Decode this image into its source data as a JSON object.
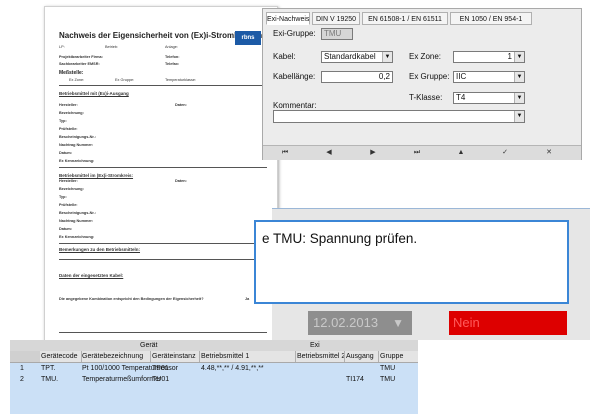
{
  "document": {
    "title": "Nachweis der Eigensicherheit von (Ex)i-Stromkreisen",
    "lp_label": "LP:",
    "betrieb_label": "Betrieb:",
    "anlage_label": "Anlage:",
    "proj_label": "Projektbearbeiter Firma:",
    "sach_label": "Sachbearbeiter EMSR:",
    "telefon_label": "Telefon:",
    "telefax_label": "Telefax:",
    "messstelle_label": "Meßstelle:",
    "exzone_label": "Ex Zone:",
    "exgruppe_label": "Ex Gruppe:",
    "tempklasse_label": "Temperaturklasse:",
    "section1": "Betriebsmittel mit (Ex)i-Ausgang",
    "section2": "Betriebsmittel im (Ex)i-Stromkreis:",
    "section3": "Bemerkungen zu den Betriebsmitteln:",
    "section4": "Daten der eingesetzten Kabel:",
    "fields_left": [
      "Hersteller:",
      "Bezeichnung:",
      "Typ:",
      "Prüfstelle:",
      "Bescheinigungs-Nr.:",
      "Nachtrag Nummer:",
      "Datum:",
      "Ex Kennzeichnung:"
    ],
    "fields_right_label": "Daten:",
    "result_line": "Die angegebene Kombination entspricht den Bedingungen der Eigensicherheit?",
    "result_value": "Ja",
    "logo_text": "rbns"
  },
  "form": {
    "tabs": [
      "Exi-Nachweis",
      "DIN V 19250",
      "EN 61508-1 / EN 61511",
      "EN 1050 / EN 954-1"
    ],
    "exi_gruppe_label": "Exi-Gruppe:",
    "exi_gruppe_value": "TMU",
    "kabel_label": "Kabel:",
    "kabel_value": "Standardkabel",
    "exzone_label": "Ex Zone:",
    "exzone_value": "1",
    "kabellaenge_label": "Kabellänge:",
    "kabellaenge_value": "0,2",
    "exgruppe_label": "Ex Gruppe:",
    "exgruppe_value": "IIC",
    "tklasse_label": "T-Klasse:",
    "tklasse_value": "T4",
    "kommentar_label": "Kommentar:",
    "kommentar_value": "",
    "nav": [
      "⏮",
      "◀",
      "▶",
      "⏭",
      "▲",
      "✓",
      "✕"
    ]
  },
  "message": {
    "text": "e TMU: Spannung prüfen.",
    "date": "12.02.2013",
    "status": "Nein"
  },
  "grid": {
    "group_headers": [
      "Gerät",
      "Exi"
    ],
    "columns": [
      "Gerätecode",
      "Gerätebezeichnung",
      "Geräteinstanz",
      "Betriebsmittel 1",
      "Betriebsmittel 2",
      "Ausgang",
      "Gruppe"
    ],
    "rows": [
      {
        "num": "1",
        "code": "TPT.",
        "bez": "Pt 100/1000 Temperatursensor",
        "inst": "TP01",
        "bm1": "4.48,**,** / 4.91,**,**",
        "bm2": "",
        "aus": "",
        "gruppe": "TMU"
      },
      {
        "num": "2",
        "code": "TMU.",
        "bez": "Temperaturmeßumformer",
        "inst": "TU01",
        "bm1": "",
        "bm2": "",
        "aus": "TI174",
        "gruppe": "TMU"
      }
    ]
  },
  "colors": {
    "accent_blue": "#3b86d6",
    "status_red": "#dd0000",
    "grid_bg": "#cbe0f6"
  }
}
